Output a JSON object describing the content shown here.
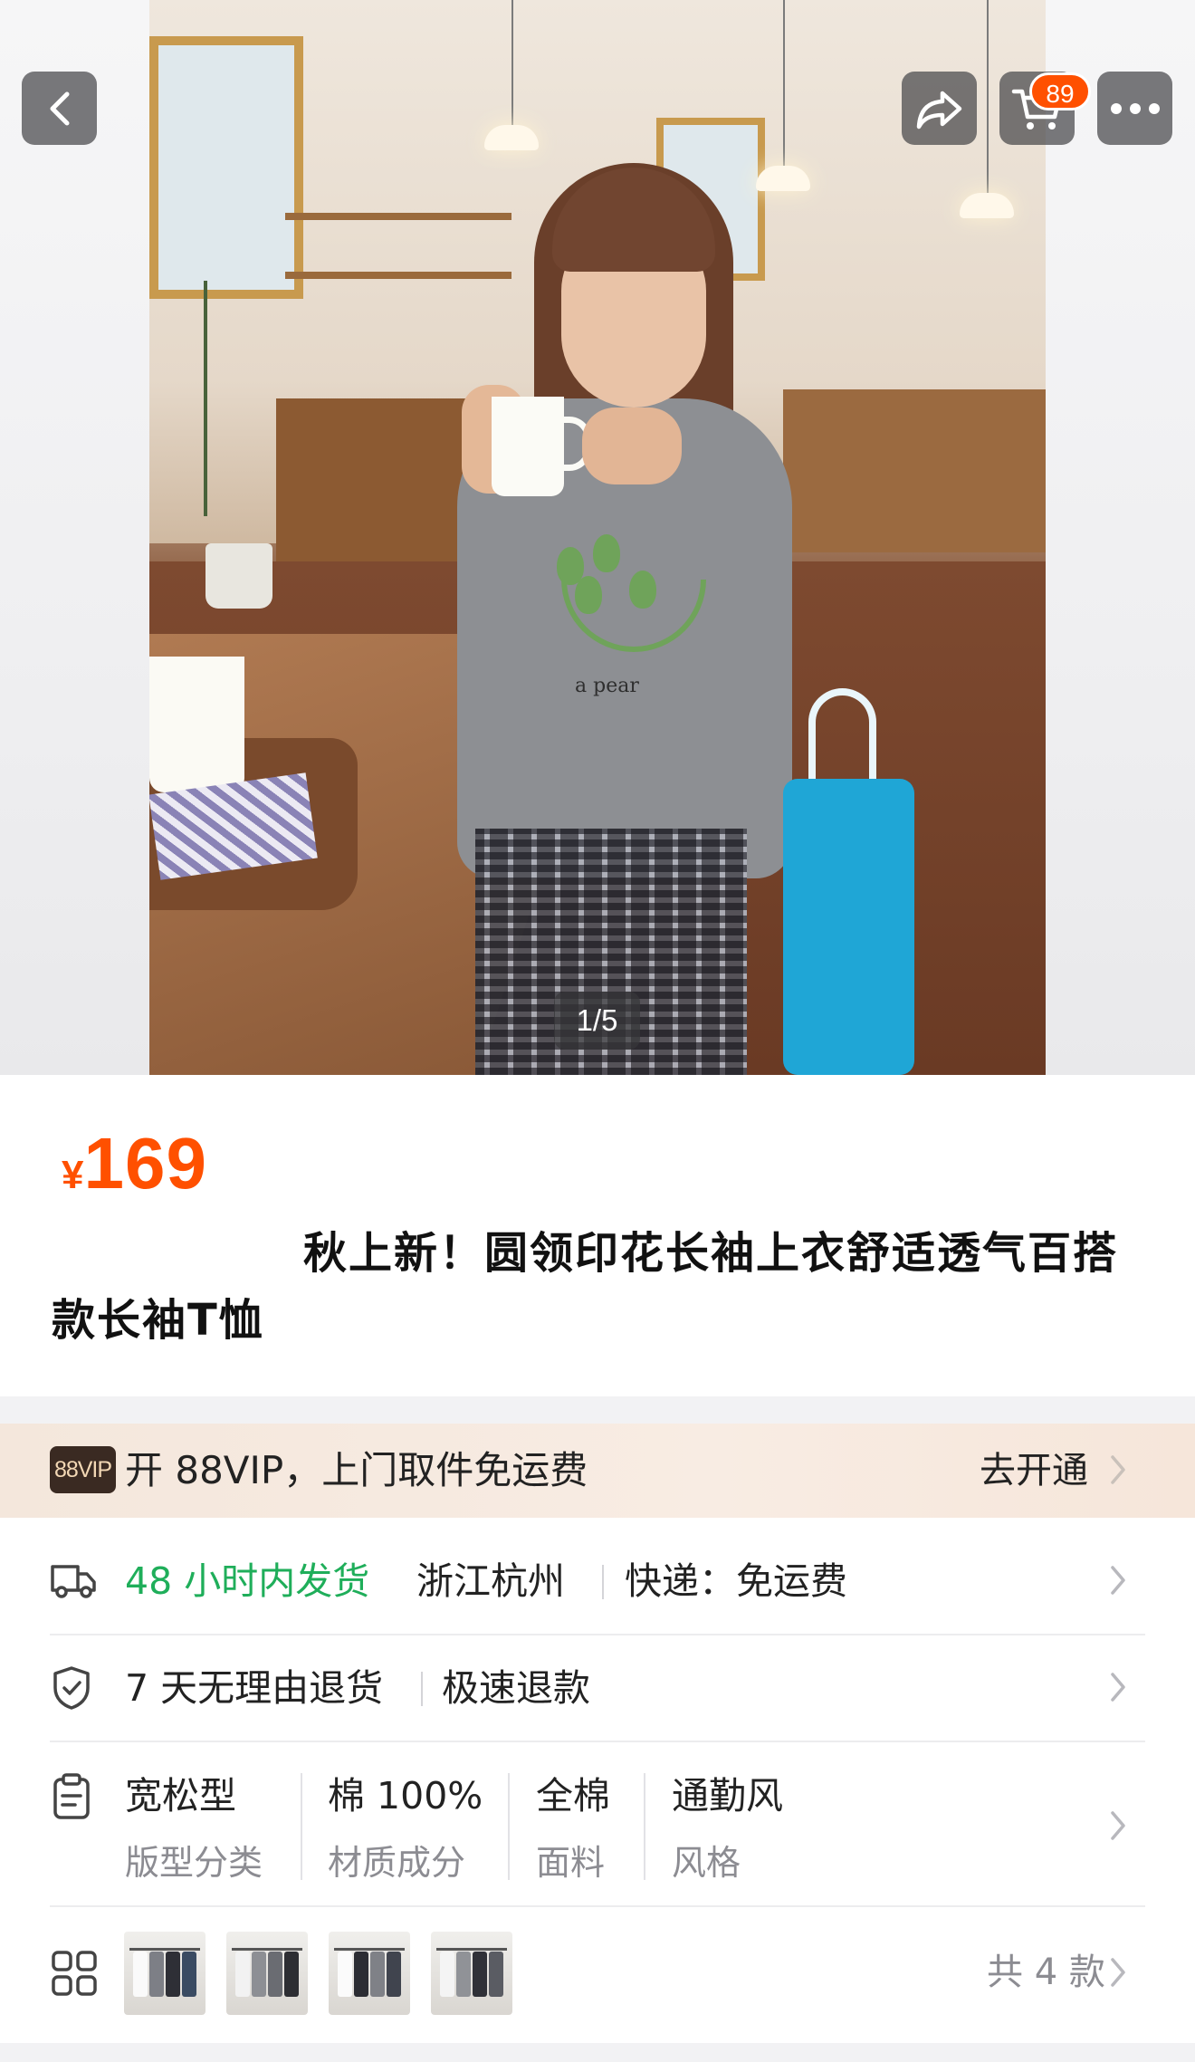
{
  "header": {
    "cart_count": "89",
    "image_counter": "1/5"
  },
  "product": {
    "currency": "¥",
    "price": "169",
    "title": "秋上新！圆领印花长袖上衣舒适透气百搭款长袖T恤"
  },
  "vip_bar": {
    "badge": "88VIP",
    "text": "开 88VIP，上门取件免运费",
    "action": "去开通"
  },
  "shipping": {
    "delivery": "48 小时内发货",
    "origin": "浙江杭州",
    "express": "快递：免运费"
  },
  "returns": {
    "policy": "7 天无理由退货",
    "refund": "极速退款"
  },
  "attributes": [
    {
      "value": "宽松型",
      "label": "版型分类"
    },
    {
      "value": "棉 100%",
      "label": "材质成分"
    },
    {
      "value": "全棉",
      "label": "面料"
    },
    {
      "value": "通勤风",
      "label": "风格"
    }
  ],
  "variants": {
    "count_text": "共 4 款"
  },
  "colors": {
    "accent": "#ff5000",
    "green": "#1fae5a",
    "vip_bg": "#f4e7dc"
  }
}
